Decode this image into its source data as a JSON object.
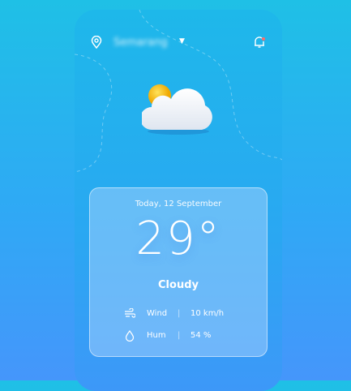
{
  "header": {
    "location": "Semarang",
    "location_icon": "map-pin-icon",
    "dropdown_icon": "chevron-down-icon",
    "notification_icon": "bell-icon",
    "notification_dot_color": "#ff6b6b"
  },
  "weather": {
    "icon": "partly-cloudy-icon",
    "date": "Today, 12 September",
    "temperature": "29°",
    "condition": "Cloudy",
    "details": [
      {
        "icon": "wind-icon",
        "label": "Wind",
        "value": "10 km/h"
      },
      {
        "icon": "droplet-icon",
        "label": "Hum",
        "value": "54 %"
      }
    ]
  }
}
